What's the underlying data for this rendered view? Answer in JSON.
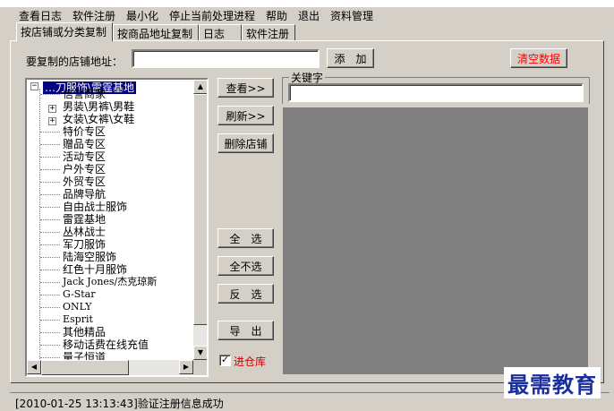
{
  "window": {
    "title": ""
  },
  "menu": [
    "查看日志",
    "软件注册",
    "最小化",
    "停止当前处理进程",
    "帮助",
    "退出",
    "资料管理"
  ],
  "tabs": [
    "按店铺或分类复制",
    "按商品地址复制",
    "日志",
    "软件注册"
  ],
  "form": {
    "store_url_label": "要复制的店铺地址：",
    "store_url_value": "",
    "add_button": "添　加",
    "clear_button": "清空数据"
  },
  "tree": {
    "root": "…刀服饰\\雷霆基地",
    "nodes": [
      "信誉商家",
      "男装\\男裤\\男鞋",
      "女装\\女裤\\女鞋",
      "特价专区",
      "赠品专区",
      "活动专区",
      "户外专区",
      "外贸专区",
      "品牌导航",
      "自由战士服饰",
      "雷霆基地",
      "丛林战士",
      "军刀服饰",
      "陆海空服饰",
      "红色十月服饰",
      "Jack Jones/杰克琼斯",
      "G-Star",
      "ONLY",
      "Esprit",
      "其他精品",
      "移动话费在线充值",
      "量子恒道"
    ]
  },
  "buttons": {
    "view": "查看>>",
    "refresh": "刷新>>",
    "delete_store": "删除店铺",
    "select_all": "全　选",
    "select_none": "全不选",
    "invert": "反　选",
    "export": "导　出"
  },
  "checkbox": {
    "label": "进仓库",
    "checked": true,
    "mark": "✓"
  },
  "keyword": {
    "label": "关键字",
    "value": ""
  },
  "status": "[2010-01-25 13:13:43]验证注册信息成功",
  "watermark": "最需教育",
  "colors": {
    "selection": "#000080",
    "red_text": "#ff0000",
    "watermark": "#1a2e9c",
    "panel_gray": "#808080"
  }
}
